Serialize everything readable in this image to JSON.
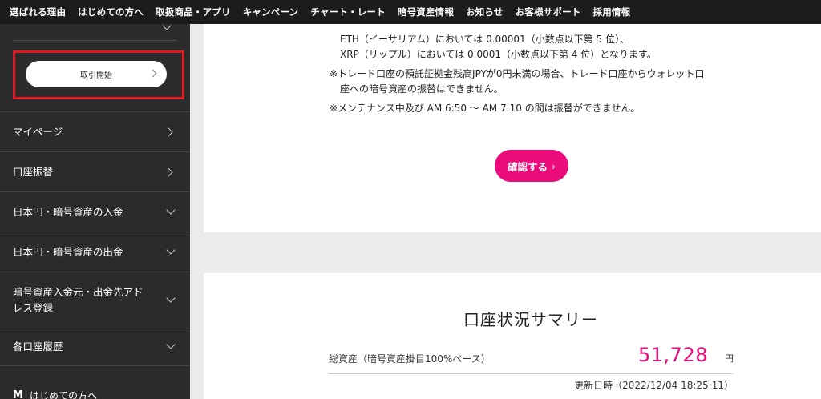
{
  "top_nav": {
    "items": [
      "選ばれる理由",
      "はじめての方へ",
      "取扱商品・アプリ",
      "キャンペーン",
      "チャート・レート",
      "暗号資産情報",
      "お知らせ",
      "お客様サポート",
      "採用情報"
    ]
  },
  "sidebar": {
    "start_button_label": "取引開始",
    "items": [
      {
        "label": "マイページ",
        "chevron": "right"
      },
      {
        "label": "口座振替",
        "chevron": "right"
      },
      {
        "label": "日本円・暗号資産の入金",
        "chevron": "down"
      },
      {
        "label": "日本円・暗号資産の出金",
        "chevron": "down"
      },
      {
        "label": "暗号資産入金元・出金先アドレス登録",
        "chevron": "down"
      },
      {
        "label": "各口座履歴",
        "chevron": "down"
      }
    ],
    "bottom_logo_text": "M",
    "bottom_text": "はじめての方へ"
  },
  "notes": {
    "eth_line": "ETH（イーサリアム）においては 0.00001（小数点以下第 5 位）、",
    "xrp_line": "XRP（リップル）においては 0.0001（小数点以下第 4 位）となります。",
    "trade_note_1": "※トレード口座の預託証拠金残高JPYが0円未満の場合、トレード口座からウォレット口",
    "trade_note_2": "座への暗号資産の振替はできません。",
    "maintenance_note": "※メンテナンス中及び AM 6:50 〜 AM 7:10 の間は振替ができません。"
  },
  "confirm_button": {
    "label": "確認する",
    "arrow": "›"
  },
  "summary": {
    "title": "口座状況サマリー",
    "total_label": "総資産（暗号資産掛目100%ベース）",
    "total_value": "51,728",
    "total_unit": "円",
    "updated_text": "更新日時（2022/12/04 18:25:11）"
  },
  "colors": {
    "accent": "#ec0b7b",
    "highlight_border": "#e01b24",
    "sidebar_bg": "#2b2b2b",
    "topnav_bg": "#1c1c1c"
  }
}
